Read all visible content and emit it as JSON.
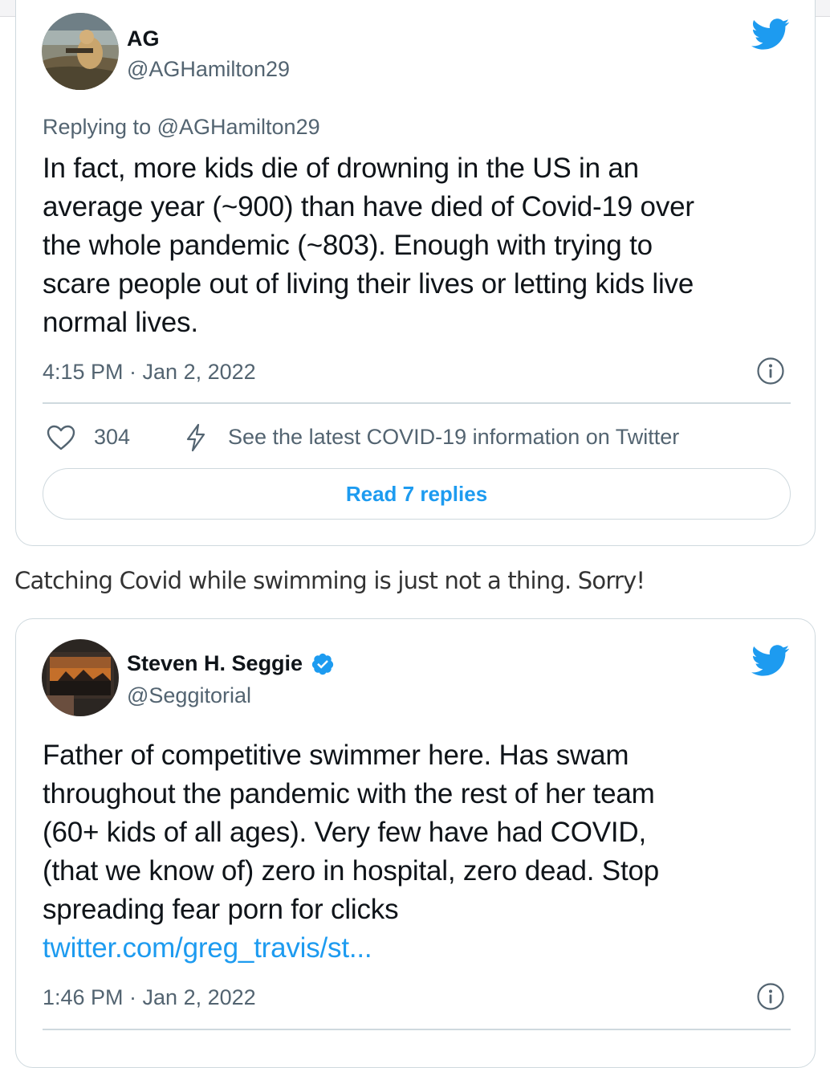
{
  "tweet1": {
    "author_name": "AG",
    "author_handle": "@AGHamilton29",
    "reply_prefix": "Replying to",
    "reply_to": "@AGHamilton29",
    "text_lines": [
      "In fact, more kids die of drowning in the US in an",
      "average year (~900) than have died of Covid-19 over",
      "the whole pandemic (~803). Enough with trying to",
      "scare people out of living their lives or letting kids live",
      "normal lives."
    ],
    "timestamp": "4:15 PM · Jan 2, 2022",
    "like_count": "304",
    "covid_info": "See the latest COVID-19 information on Twitter",
    "read_replies": "Read 7 replies"
  },
  "caption": "Catching Covid while swimming is just not a thing. Sorry!",
  "tweet2": {
    "author_name": "Steven H. Seggie",
    "author_handle": "@Seggitorial",
    "text_lines": [
      "Father of competitive swimmer here. Has swam",
      "throughout the pandemic with the rest of her team",
      "(60+ kids of all ages). Very few have had COVID,",
      "(that we know of) zero in hospital, zero dead. Stop",
      "spreading fear porn for clicks"
    ],
    "link": "twitter.com/greg_travis/st...",
    "timestamp": "1:46 PM · Jan 2, 2022"
  },
  "colors": {
    "twitter_blue": "#1d9bf0",
    "verified_blue": "#1d9bf0",
    "secondary_text": "#536471",
    "border": "#cfd9de"
  },
  "icons": [
    "twitter-bird-icon",
    "info-icon",
    "heart-icon",
    "bolt-icon",
    "verified-badge-icon"
  ]
}
